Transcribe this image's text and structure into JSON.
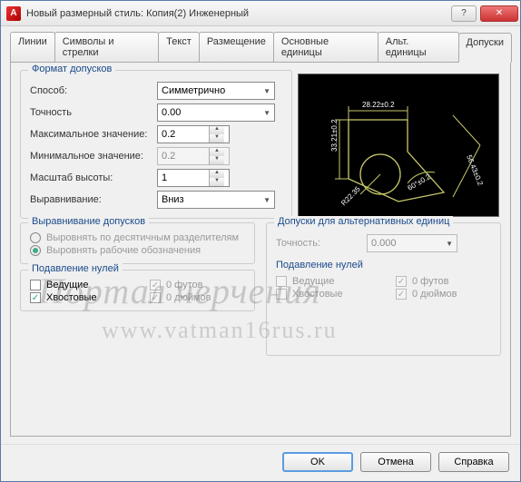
{
  "window": {
    "title": "Новый размерный стиль: Копия(2) Инженерный",
    "app_icon_letter": "A"
  },
  "tabs": [
    "Линии",
    "Символы и стрелки",
    "Текст",
    "Размещение",
    "Основные единицы",
    "Альт. единицы",
    "Допуски"
  ],
  "active_tab": 6,
  "tolerance_format": {
    "legend": "Формат допусков",
    "method_label": "Способ:",
    "method_value": "Симметрично",
    "precision_label": "Точность",
    "precision_value": "0.00",
    "max_label": "Максимальное значение:",
    "max_value": "0.2",
    "min_label": "Минимальное значение:",
    "min_value": "0.2",
    "scale_label": "Масштаб высоты:",
    "scale_value": "1",
    "align_label": "Выравнивание:",
    "align_value": "Вниз"
  },
  "tolerance_align": {
    "legend": "Выравнивание допусков",
    "opt1": "Выровнять по десятичным разделителям",
    "opt2": "Выровнять рабочие обозначения",
    "selected": 1
  },
  "zero_suppress": {
    "legend": "Подавление нулей",
    "leading": "Ведущие",
    "trailing": "Хвостовые",
    "feet": "0 футов",
    "inches": "0 дюймов",
    "leading_checked": false,
    "trailing_checked": true,
    "feet_checked": true,
    "inches_checked": true
  },
  "alt_units": {
    "legend": "Допуски для альтернативных единиц",
    "precision_label": "Точность:",
    "precision_value": "0.000",
    "zero_legend": "Подавление нулей",
    "leading": "Ведущие",
    "trailing": "Хвостовые",
    "feet": "0 футов",
    "inches": "0 дюймов"
  },
  "buttons": {
    "ok": "OK",
    "cancel": "Отмена",
    "help": "Справка"
  },
  "preview_dims": {
    "top": "28.22±0.2",
    "left": "33.21±0.2",
    "right": "56.43±0.2",
    "angle": "60°±0.2",
    "radius": "R22.35"
  },
  "watermark": {
    "line1": "Портал черчения",
    "line2": "www.vatman16rus.ru"
  }
}
